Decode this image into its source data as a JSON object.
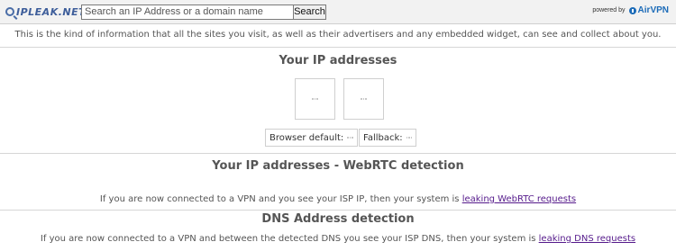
{
  "header": {
    "logo_text": "IPLEAK.NET",
    "search": {
      "placeholder": "Search an IP Address or a domain name",
      "value": ""
    },
    "search_button_label": "Search",
    "powered_by_label": "powered by",
    "powered_brand": "AirVPN"
  },
  "intro": "This is the kind of information that all the sites you visit, as well as their advertisers and any embedded widget, can see and collect about you.",
  "ip_section": {
    "title": "Your IP addresses",
    "boxes": [
      "loading",
      "loading"
    ],
    "browser_default_label": "Browser default:",
    "fallback_label": "Fallback:"
  },
  "webrtc_section": {
    "title": "Your IP addresses - WebRTC detection",
    "note_prefix": "If you are now connected to a VPN and you see your ISP IP, then your system is ",
    "note_link": "leaking WebRTC requests"
  },
  "dns_section": {
    "title": "DNS Address detection",
    "note_prefix": "If you are now connected to a VPN and between the detected DNS you see your ISP DNS, then your system is ",
    "note_link": "leaking DNS requests"
  },
  "colors": {
    "link": "#551a8b",
    "brand": "#1c6bb8",
    "logo": "#3d5d9a"
  }
}
